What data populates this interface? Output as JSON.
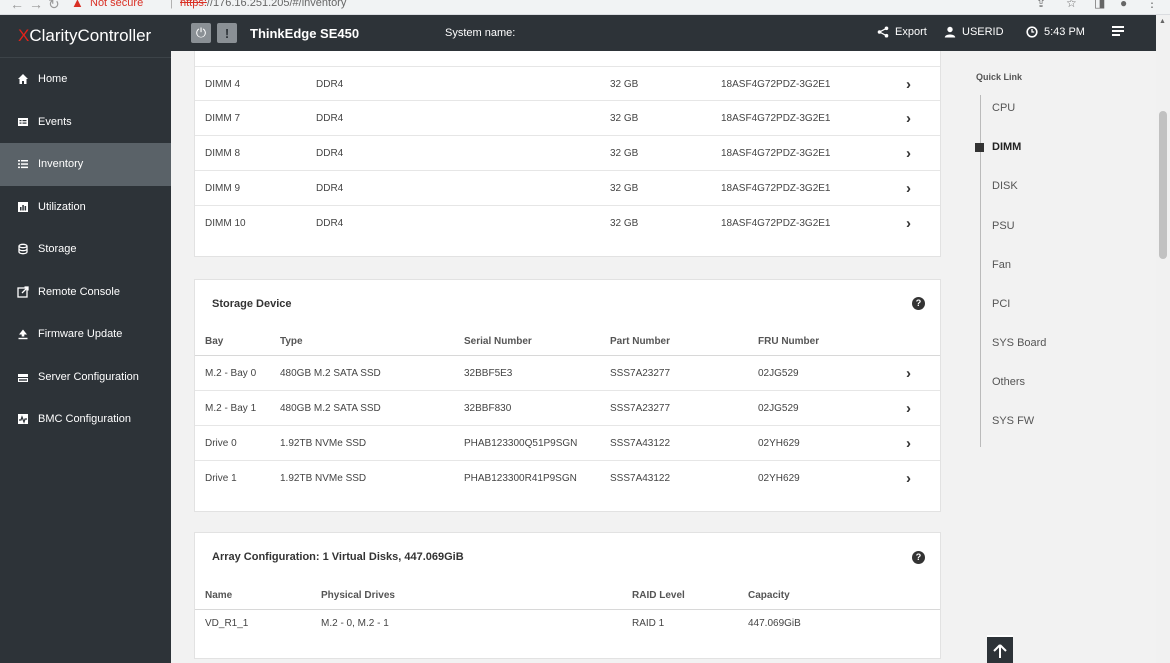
{
  "browser": {
    "not_secure": "Not secure",
    "url_scheme": "https:",
    "url_rest": "//176.16.251.205/#/inventory"
  },
  "brand": {
    "x": "X",
    "rest": "Clarity",
    "controller": " Controller"
  },
  "sidebar": {
    "items": [
      {
        "label": "Home",
        "icon": "home-icon"
      },
      {
        "label": "Events",
        "icon": "events-icon"
      },
      {
        "label": "Inventory",
        "icon": "inventory-icon"
      },
      {
        "label": "Utilization",
        "icon": "utilization-icon"
      },
      {
        "label": "Storage",
        "icon": "storage-icon"
      },
      {
        "label": "Remote Console",
        "icon": "remote-console-icon"
      },
      {
        "label": "Firmware Update",
        "icon": "firmware-update-icon"
      },
      {
        "label": "Server Configuration",
        "icon": "server-config-icon"
      },
      {
        "label": "BMC Configuration",
        "icon": "bmc-config-icon"
      }
    ],
    "active": "Inventory"
  },
  "topbar": {
    "model": "ThinkEdge SE450",
    "system_name_label": "System name:",
    "export": "Export",
    "user": "USERID",
    "time": "5:43 PM"
  },
  "dimm_rows": [
    {
      "name": "DIMM 4",
      "type": "DDR4",
      "size": "32 GB",
      "part": "18ASF4G72PDZ-3G2E1"
    },
    {
      "name": "DIMM 7",
      "type": "DDR4",
      "size": "32 GB",
      "part": "18ASF4G72PDZ-3G2E1"
    },
    {
      "name": "DIMM 8",
      "type": "DDR4",
      "size": "32 GB",
      "part": "18ASF4G72PDZ-3G2E1"
    },
    {
      "name": "DIMM 9",
      "type": "DDR4",
      "size": "32 GB",
      "part": "18ASF4G72PDZ-3G2E1"
    },
    {
      "name": "DIMM 10",
      "type": "DDR4",
      "size": "32 GB",
      "part": "18ASF4G72PDZ-3G2E1"
    }
  ],
  "storage": {
    "title": "Storage Device",
    "headers": [
      "Bay",
      "Type",
      "Serial Number",
      "Part Number",
      "FRU Number"
    ],
    "rows": [
      {
        "bay": "M.2 - Bay 0",
        "type": "480GB M.2 SATA SSD",
        "serial": "32BBF5E3",
        "part": "SSS7A23277",
        "fru": "02JG529"
      },
      {
        "bay": "M.2 - Bay 1",
        "type": "480GB M.2 SATA SSD",
        "serial": "32BBF830",
        "part": "SSS7A23277",
        "fru": "02JG529"
      },
      {
        "bay": "Drive 0",
        "type": "1.92TB NVMe SSD",
        "serial": "PHAB123300Q51P9SGN",
        "part": "SSS7A43122",
        "fru": "02YH629"
      },
      {
        "bay": "Drive 1",
        "type": "1.92TB NVMe SSD",
        "serial": "PHAB123300R41P9SGN",
        "part": "SSS7A43122",
        "fru": "02YH629"
      }
    ]
  },
  "array": {
    "title": "Array Configuration:  1 Virtual Disks, 447.069GiB",
    "headers": [
      "Name",
      "Physical Drives",
      "RAID Level",
      "Capacity"
    ],
    "rows": [
      {
        "name": "VD_R1_1",
        "drives": "M.2 - 0, M.2 - 1",
        "raid": "RAID 1",
        "capacity": "447.069GiB"
      }
    ]
  },
  "quick_link": {
    "title": "Quick Link",
    "items": [
      "CPU",
      "DIMM",
      "DISK",
      "PSU",
      "Fan",
      "PCI",
      "SYS Board",
      "Others",
      "SYS FW"
    ],
    "active": "DIMM"
  },
  "colors": {
    "sidebar_bg": "#2d3338",
    "active_item_bg": "#5a6268",
    "brand_accent": "#e2231a"
  }
}
